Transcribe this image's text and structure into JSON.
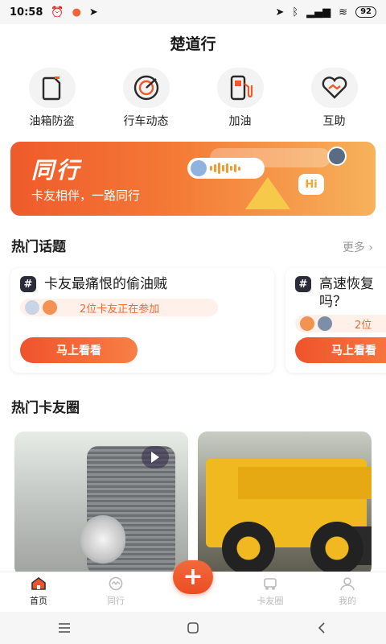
{
  "status_bar": {
    "time": "10:58",
    "battery": "92"
  },
  "header": {
    "title": "楚道行"
  },
  "quick_functions": [
    {
      "label": "油箱防盗",
      "icon": "fuel-tank-icon"
    },
    {
      "label": "行车动态",
      "icon": "target-icon"
    },
    {
      "label": "加油",
      "icon": "fuel-pump-icon"
    },
    {
      "label": "互助",
      "icon": "handshake-heart-icon"
    }
  ],
  "banner": {
    "title": "同行",
    "subtitle": "卡友相伴，一路同行",
    "bubble_text": "Hi"
  },
  "hot_topics": {
    "title": "热门话题",
    "more": "更多",
    "cards": [
      {
        "title": "卡友最痛恨的偷油贼",
        "meta": "2位卡友正在参加",
        "button": "马上看看"
      },
      {
        "title": "高速恢复\n吗？",
        "meta": "2位",
        "button": "马上看看"
      }
    ]
  },
  "hot_circles": {
    "title": "热门卡友圈"
  },
  "bottom_nav": {
    "items": [
      {
        "label": "首页",
        "icon": "home-icon",
        "active": true
      },
      {
        "label": "同行",
        "icon": "chat-icon",
        "active": false
      },
      {
        "label": "卡友圈",
        "icon": "truck-circle-icon",
        "active": false
      },
      {
        "label": "我的",
        "icon": "profile-icon",
        "active": false
      }
    ],
    "fab": "+"
  },
  "colors": {
    "accent": "#ef5a2b",
    "accent_light": "#fff1ea",
    "text": "#222222"
  }
}
